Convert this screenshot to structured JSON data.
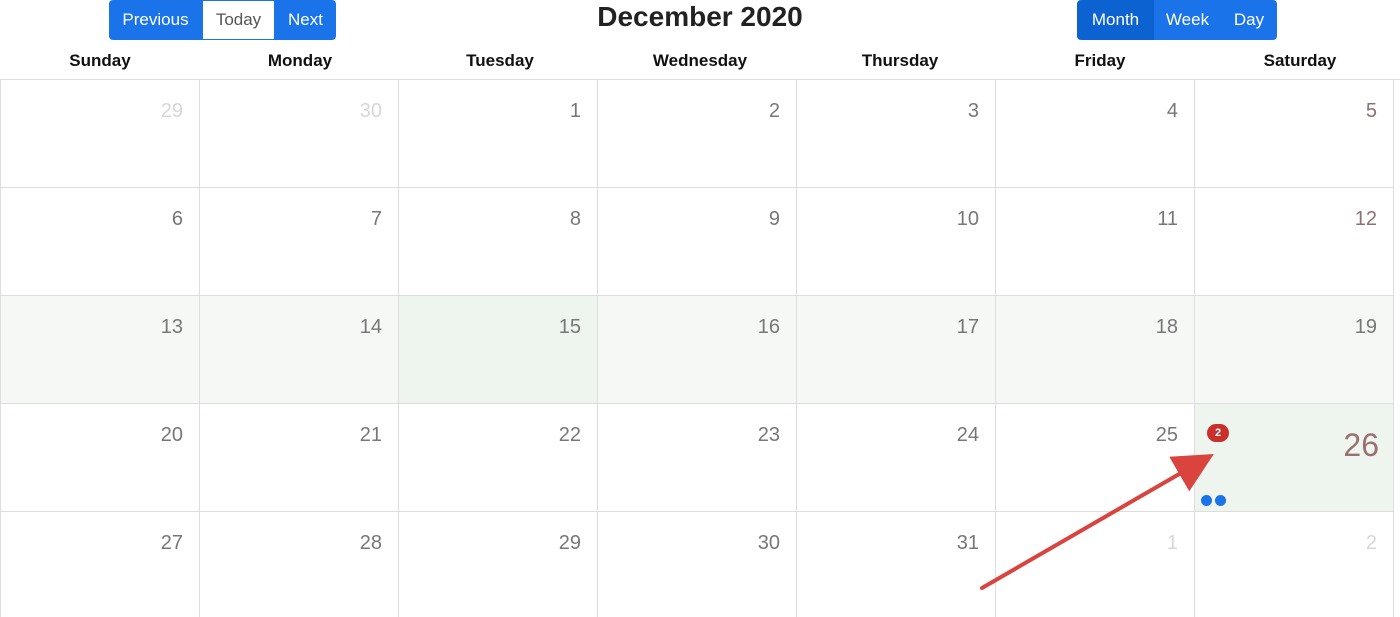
{
  "toolbar": {
    "previous_label": "Previous",
    "today_label": "Today",
    "next_label": "Next",
    "title": "December 2020",
    "views": {
      "month_label": "Month",
      "week_label": "Week",
      "day_label": "Day",
      "active": "Month"
    }
  },
  "weekdays": [
    "Sunday",
    "Monday",
    "Tuesday",
    "Wednesday",
    "Thursday",
    "Friday",
    "Saturday"
  ],
  "weeks": [
    [
      {
        "date": "29",
        "other_month": true
      },
      {
        "date": "30",
        "other_month": true
      },
      {
        "date": "1"
      },
      {
        "date": "2"
      },
      {
        "date": "3"
      },
      {
        "date": "4"
      },
      {
        "date": "5",
        "weekend": true
      }
    ],
    [
      {
        "date": "6"
      },
      {
        "date": "7"
      },
      {
        "date": "8"
      },
      {
        "date": "9"
      },
      {
        "date": "10"
      },
      {
        "date": "11"
      },
      {
        "date": "12",
        "weekend": true
      }
    ],
    [
      {
        "date": "13",
        "current_week": true
      },
      {
        "date": "14",
        "current_week": true
      },
      {
        "date": "15",
        "current_week": true,
        "today": true
      },
      {
        "date": "16",
        "current_week": true
      },
      {
        "date": "17",
        "current_week": true
      },
      {
        "date": "18",
        "current_week": true
      },
      {
        "date": "19",
        "current_week": true
      }
    ],
    [
      {
        "date": "20"
      },
      {
        "date": "21"
      },
      {
        "date": "22"
      },
      {
        "date": "23"
      },
      {
        "date": "24"
      },
      {
        "date": "25"
      },
      {
        "date": "26",
        "selected": true,
        "event_count": "2",
        "event_dots": 2
      }
    ],
    [
      {
        "date": "27"
      },
      {
        "date": "28"
      },
      {
        "date": "29"
      },
      {
        "date": "30"
      },
      {
        "date": "31"
      },
      {
        "date": "1",
        "other_month": true
      },
      {
        "date": "2",
        "other_month": true
      }
    ]
  ],
  "colors": {
    "accent": "#1a73e8",
    "badge": "#c9302c",
    "selected_bg": "#eef4ee",
    "annotation_arrow": "#d9443f"
  },
  "icons": {
    "annotation": "arrow-icon"
  }
}
